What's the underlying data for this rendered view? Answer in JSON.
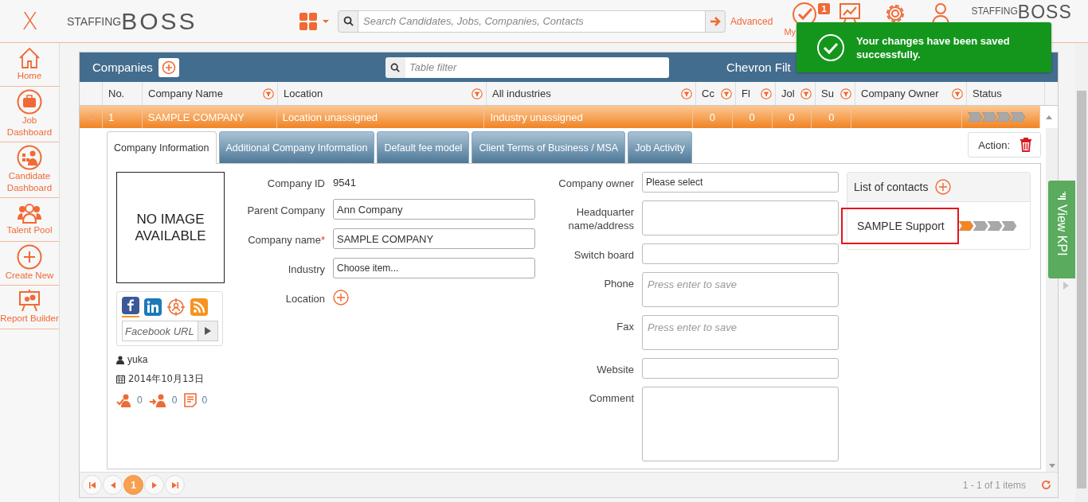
{
  "header": {
    "close": "X",
    "logo": {
      "small": "STAFFING",
      "large": "BOSS"
    },
    "search": {
      "placeholder": "Search Candidates, Jobs, Companies, Contacts"
    },
    "advanced": "Advanced",
    "nav": [
      {
        "kind": "taskboard",
        "label": "My",
        "badge": "1"
      },
      {
        "kind": "analytics"
      },
      {
        "kind": "settings"
      },
      {
        "kind": "account"
      }
    ],
    "brand": {
      "small": "STAFFING",
      "large": "BOSS"
    }
  },
  "toast": {
    "message": "Your changes have been saved successfully."
  },
  "sidebar": {
    "items": [
      {
        "kind": "home",
        "label": "Home"
      },
      {
        "kind": "job",
        "label": "Job Dashboard"
      },
      {
        "kind": "candidate",
        "label": "Candidate Dashboard"
      },
      {
        "kind": "talent",
        "label": "Talent Pool"
      },
      {
        "kind": "create",
        "label": "Create New"
      },
      {
        "kind": "report",
        "label": "Report Builder"
      }
    ]
  },
  "panel": {
    "title": "Companies",
    "filter": {
      "placeholder": "Table filter"
    },
    "chevron_filters": "Chevron Filt",
    "columns": [
      {
        "label": "No.",
        "filterable": false
      },
      {
        "label": "Company Name",
        "filterable": true
      },
      {
        "label": "Location",
        "filterable": true
      },
      {
        "label": "All industries",
        "filterable": true
      },
      {
        "label": "Cc",
        "filterable": true
      },
      {
        "label": "Fl",
        "filterable": true
      },
      {
        "label": "Jol",
        "filterable": true
      },
      {
        "label": "Su",
        "filterable": true
      },
      {
        "label": "Company Owner",
        "filterable": true
      },
      {
        "label": "Status",
        "filterable": false
      }
    ],
    "rows": [
      {
        "selected": true,
        "expanded": true,
        "cells": [
          "1",
          "SAMPLE COMPANY",
          "Location unassigned",
          "Industry unassigned",
          "0",
          "0",
          "0",
          "0",
          ""
        ],
        "stars": 0
      }
    ],
    "pager": {
      "page": "1",
      "summary": "1 - 1 of 1 items"
    }
  },
  "detail": {
    "tabs": [
      {
        "label": "Company Information",
        "selected": true
      },
      {
        "label": "Additional Company Information",
        "selected": false
      },
      {
        "label": "Default fee model",
        "selected": false
      },
      {
        "label": "Client Terms of Business / MSA",
        "selected": false
      },
      {
        "label": "Job Activity",
        "selected": false
      }
    ],
    "action": "Action:",
    "image": "NO IMAGE AVAILABLE",
    "social": {
      "placeholder": "Facebook URL"
    },
    "created_by": "yuka",
    "date": "2014年10月13日",
    "counts": [
      "0",
      "0",
      "0"
    ],
    "fields_left": [
      {
        "kind": "text",
        "label": "Company ID",
        "value": "9541"
      },
      {
        "kind": "input",
        "label": "Parent Company",
        "value": "Ann Company"
      },
      {
        "kind": "input",
        "label": "Company name",
        "required_mark": "*",
        "value": "SAMPLE COMPANY"
      },
      {
        "kind": "select",
        "label": "Industry",
        "value": "Choose item..."
      },
      {
        "kind": "add",
        "label": "Location"
      }
    ],
    "fields_right": [
      {
        "kind": "select",
        "label": "Company owner",
        "value": "Please select"
      },
      {
        "kind": "textarea",
        "label": "Headquarter name/address"
      },
      {
        "kind": "input",
        "label": "Switch board"
      },
      {
        "kind": "textarea",
        "label": "Phone",
        "placeholder": "Press enter to save"
      },
      {
        "kind": "textarea",
        "label": "Fax",
        "placeholder": "Press enter to save"
      },
      {
        "kind": "input",
        "label": "Website"
      },
      {
        "kind": "bigarea",
        "label": "Comment"
      }
    ],
    "contacts": {
      "title": "List of contacts",
      "items": [
        {
          "name": "SAMPLE Support",
          "highlighted": true,
          "stars": 1
        }
      ]
    }
  },
  "kpi": {
    "label": "View KPI"
  }
}
